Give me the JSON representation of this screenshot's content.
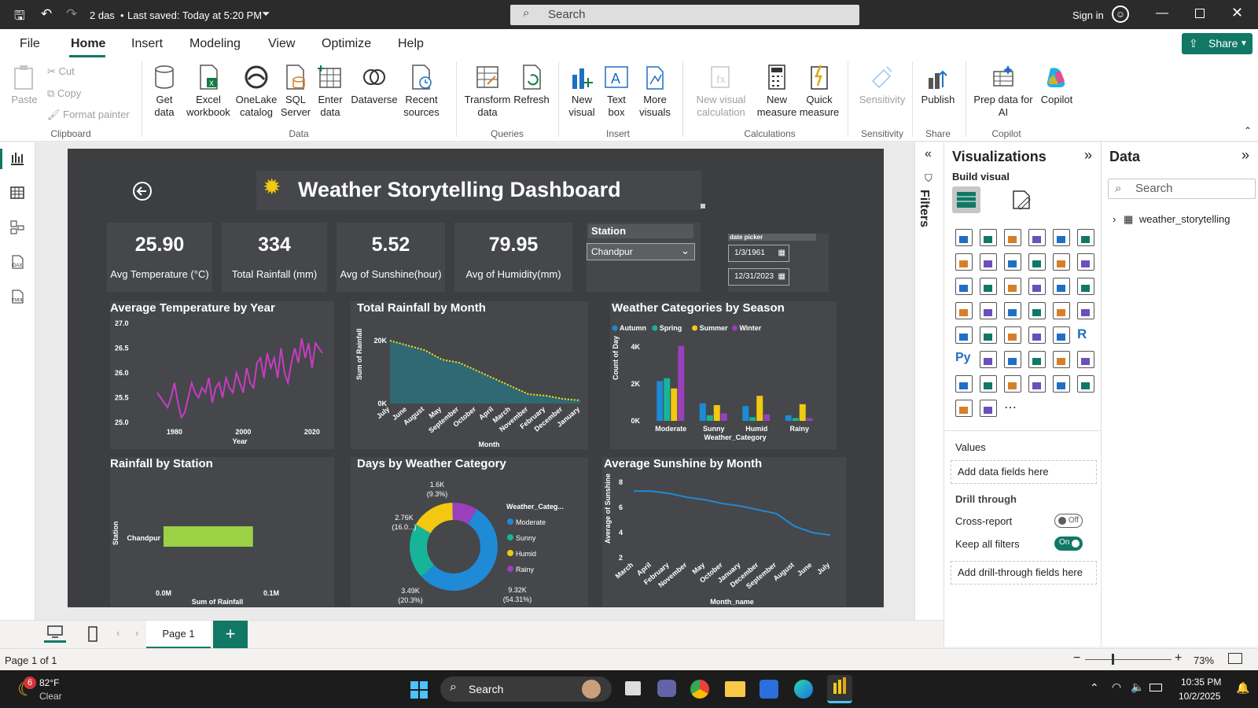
{
  "titlebar": {
    "file_name": "2 das",
    "saved": "Last saved: Today at 5:20 PM",
    "search_placeholder": "Search",
    "signin": "Sign in"
  },
  "menu": [
    "File",
    "Home",
    "Insert",
    "Modeling",
    "View",
    "Optimize",
    "Help"
  ],
  "share_label": "Share",
  "ribbon": {
    "clipboard": {
      "paste": "Paste",
      "cut": "Cut",
      "copy": "Copy",
      "format_painter": "Format painter",
      "group": "Clipboard"
    },
    "data": {
      "get_data": "Get\ndata",
      "excel": "Excel\nworkbook",
      "onelake": "OneLake\ncatalog",
      "sql": "SQL\nServer",
      "enter": "Enter\ndata",
      "dataverse": "Dataverse",
      "recent": "Recent\nsources",
      "group": "Data"
    },
    "queries": {
      "transform": "Transform\ndata",
      "refresh": "Refresh",
      "group": "Queries"
    },
    "insert": {
      "new_visual": "New\nvisual",
      "text_box": "Text\nbox",
      "more_visuals": "More\nvisuals",
      "group": "Insert"
    },
    "calculations": {
      "new_visual_calc": "New visual\ncalculation",
      "new_measure": "New\nmeasure",
      "quick_measure": "Quick\nmeasure",
      "group": "Calculations"
    },
    "sensitivity": {
      "label": "Sensitivity",
      "group": "Sensitivity"
    },
    "share": {
      "publish": "Publish",
      "group": "Share"
    },
    "copilot": {
      "prep": "Prep data for\nAI",
      "copilot": "Copilot",
      "group": "Copilot"
    }
  },
  "report": {
    "title": "Weather Storytelling Dashboard",
    "kpis": [
      {
        "value": "25.90",
        "label": "Avg Temperature (°C)"
      },
      {
        "value": "334",
        "label": "Total Rainfall (mm)"
      },
      {
        "value": "5.52",
        "label": "Avg of Sunshine(hour)"
      },
      {
        "value": "79.95",
        "label": "Avg of Humidity(mm)"
      }
    ],
    "station_slicer": {
      "title": "Station",
      "value": "Chandpur"
    },
    "date_picker": {
      "title": "date picker",
      "start": "1/3/1961",
      "end": "12/31/2023"
    },
    "visual_titles": {
      "temp_by_year": "Average Temperature by Year",
      "rain_by_month": "Total Rainfall by Month",
      "cat_by_season": "Weather Categories by Season",
      "rain_by_station": "Rainfall by Station",
      "days_by_cat": "Days by Weather Category",
      "sun_by_month": "Average Sunshine by Month"
    }
  },
  "chart_data": [
    {
      "type": "line",
      "title": "Average Temperature by Year",
      "xlabel": "Year",
      "ylabel": "",
      "ylim": [
        25.0,
        27.0
      ],
      "yticks": [
        "27.0",
        "26.5",
        "26.0",
        "25.5",
        "25.0"
      ],
      "xticks": [
        "1980",
        "2000",
        "2020"
      ],
      "color": "#c83cc4",
      "x": [
        1975,
        1976,
        1977,
        1978,
        1979,
        1980,
        1981,
        1982,
        1983,
        1984,
        1985,
        1986,
        1987,
        1988,
        1989,
        1990,
        1991,
        1992,
        1993,
        1994,
        1995,
        1996,
        1997,
        1998,
        1999,
        2000,
        2001,
        2002,
        2003,
        2004,
        2005,
        2006,
        2007,
        2008,
        2009,
        2010,
        2011,
        2012,
        2013,
        2014,
        2015,
        2016,
        2017,
        2018,
        2019,
        2020,
        2021,
        2022,
        2023
      ],
      "values": [
        25.6,
        25.5,
        25.4,
        25.3,
        25.5,
        25.8,
        25.4,
        25.1,
        25.2,
        25.5,
        25.8,
        25.6,
        25.5,
        25.7,
        25.6,
        25.9,
        25.4,
        25.7,
        25.8,
        25.5,
        25.9,
        25.7,
        25.6,
        26.0,
        25.8,
        25.6,
        26.1,
        25.8,
        25.7,
        26.2,
        26.3,
        25.9,
        26.4,
        26.1,
        26.3,
        25.9,
        26.5,
        26.0,
        25.8,
        26.2,
        26.5,
        26.2,
        26.7,
        26.3,
        26.6,
        26.1,
        26.6,
        26.5,
        26.4
      ]
    },
    {
      "type": "area",
      "title": "Total Rainfall by Month",
      "xlabel": "Month",
      "ylabel": "Sum of Rainfall",
      "ylim": [
        0,
        25000
      ],
      "yticks": [
        "20K",
        "0K"
      ],
      "categories": [
        "July",
        "June",
        "August",
        "May",
        "September",
        "October",
        "April",
        "March",
        "November",
        "February",
        "December",
        "January"
      ],
      "values": [
        20000,
        18500,
        17000,
        14000,
        13000,
        10500,
        8000,
        5500,
        3000,
        2500,
        1500,
        1000
      ]
    },
    {
      "type": "bar",
      "title": "Weather Categories by Season",
      "xlabel": "Weather_Category",
      "ylabel": "Count of Day",
      "ylim": [
        0,
        4500
      ],
      "yticks": [
        "4K",
        "2K",
        "0K"
      ],
      "categories": [
        "Moderate",
        "Sunny",
        "Humid",
        "Rainy"
      ],
      "series": [
        {
          "name": "Autumn",
          "color": "#1f8ad6",
          "values": [
            2150,
            950,
            800,
            300
          ]
        },
        {
          "name": "Spring",
          "color": "#18b49a",
          "values": [
            2300,
            300,
            200,
            150
          ]
        },
        {
          "name": "Summer",
          "color": "#f2c811",
          "values": [
            1750,
            850,
            1350,
            900
          ]
        },
        {
          "name": "Winter",
          "color": "#9b3fbd",
          "values": [
            4050,
            400,
            350,
            150
          ]
        }
      ]
    },
    {
      "type": "bar",
      "title": "Rainfall by Station",
      "xlabel": "Sum of Rainfall",
      "ylabel": "Station",
      "categories": [
        "Chandpur"
      ],
      "values": [
        0.083
      ],
      "xticks": [
        "0.0M",
        "0.1M"
      ],
      "color": "#9bd245"
    },
    {
      "type": "pie",
      "title": "Days by Weather Category",
      "legend_title": "Weather_Categ...",
      "categories": [
        "Moderate",
        "Sunny",
        "Humid",
        "Rainy"
      ],
      "values": [
        9320,
        3490,
        2760,
        1600
      ],
      "percents": [
        "(54.31%)",
        "(20.3%)",
        "(16.0...)",
        "(9.3%)"
      ],
      "labels": [
        "9.32K",
        "3.49K",
        "2.76K",
        "1.6K"
      ],
      "colors": [
        "#1f8ad6",
        "#18b49a",
        "#f2c811",
        "#9b3fbd"
      ]
    },
    {
      "type": "line",
      "title": "Average Sunshine by Month",
      "xlabel": "Month_name",
      "ylabel": "Average of Sunshine",
      "ylim": [
        2,
        8
      ],
      "yticks": [
        "8",
        "6",
        "4",
        "2"
      ],
      "categories": [
        "March",
        "April",
        "February",
        "November",
        "May",
        "October",
        "January",
        "December",
        "September",
        "August",
        "June",
        "July"
      ],
      "values": [
        7.3,
        7.3,
        7.1,
        6.8,
        6.6,
        6.3,
        6.1,
        5.8,
        5.5,
        4.5,
        4.0,
        3.8
      ],
      "color": "#1f8ad6"
    }
  ],
  "filters_label": "Filters",
  "viz_pane": {
    "title": "Visualizations",
    "build": "Build visual",
    "values": "Values",
    "values_placeholder": "Add data fields here",
    "drill": "Drill through",
    "cross_report": "Cross-report",
    "cross_state": "Off",
    "keep_filters": "Keep all filters",
    "keep_state": "On",
    "drill_placeholder": "Add drill-through fields here"
  },
  "data_pane": {
    "title": "Data",
    "search": "Search",
    "table": "weather_storytelling"
  },
  "page_tab": "Page 1",
  "status": {
    "page": "Page 1 of 1",
    "zoom": "73%"
  },
  "taskbar": {
    "temp": "82°F",
    "cond": "Clear",
    "search": "Search",
    "time": "10:35 PM",
    "date": "10/2/2025",
    "badge": "6"
  }
}
